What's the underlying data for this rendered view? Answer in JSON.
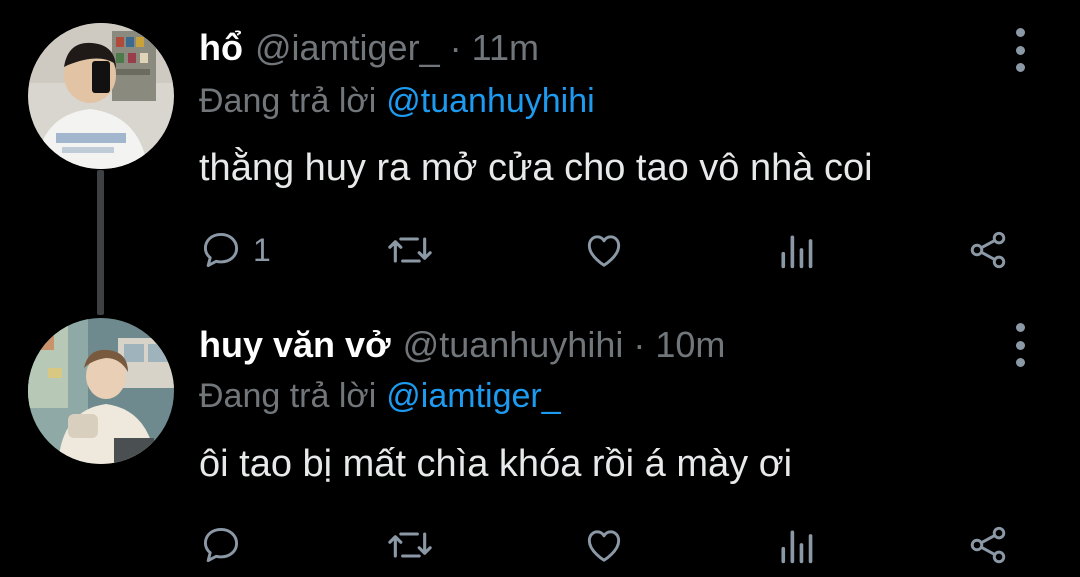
{
  "colors": {
    "background": "#000000",
    "text": "#e7e9ea",
    "muted": "#71767b",
    "link": "#1d9bf0",
    "icon": "#8b98a5"
  },
  "tweets": [
    {
      "name": "hổ",
      "handle": "@iamtiger_",
      "separator": "·",
      "time": "11m",
      "reply_prefix": "Đang trả lời",
      "reply_to": "@tuanhuyhihi",
      "text": "thằng huy ra mở cửa cho tao vô nhà coi",
      "reply_count": "1",
      "icons": [
        "reply-icon",
        "retweet-icon",
        "like-icon",
        "analytics-icon",
        "share-icon",
        "more-icon"
      ]
    },
    {
      "name": "huy văn vở",
      "handle": "@tuanhuyhihi",
      "separator": "·",
      "time": "10m",
      "reply_prefix": "Đang trả lời",
      "reply_to": "@iamtiger_",
      "text": "ôi tao bị mất chìa khóa rồi á mày ơi",
      "reply_count": "",
      "icons": [
        "reply-icon",
        "retweet-icon",
        "like-icon",
        "analytics-icon",
        "share-icon",
        "more-icon"
      ]
    }
  ]
}
